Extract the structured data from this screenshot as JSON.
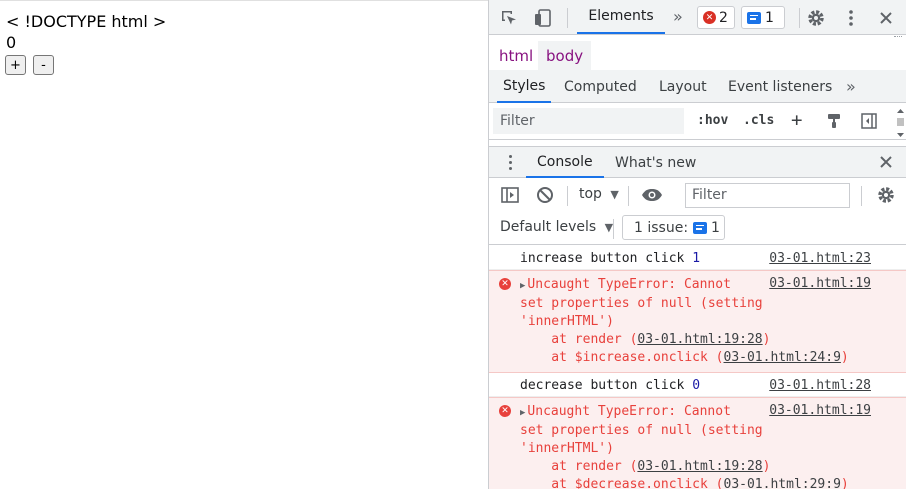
{
  "page": {
    "doctype_text": "< !DOCTYPE html >",
    "count": "0",
    "increase_label": "+",
    "decrease_label": "-"
  },
  "devtools": {
    "main_tab": "Elements",
    "more_tabs": "»",
    "error_count": "2",
    "issue_count": "1",
    "breadcrumb": [
      "html",
      "body"
    ],
    "styles_tabs": [
      "Styles",
      "Computed",
      "Layout",
      "Event listeners"
    ],
    "styles_more": "»",
    "styles_filter_placeholder": "Filter",
    "hov_label": ":hov",
    "cls_label": ".cls",
    "add_label": "+",
    "drawer_tabs": [
      "Console",
      "What's new"
    ],
    "context": "top",
    "console_filter_placeholder": "Filter",
    "levels": "Default levels",
    "issues_button": "1 issue:",
    "issues_button_count": "1"
  },
  "console": {
    "messages": [
      {
        "type": "log",
        "text": "increase button click ",
        "value": "1",
        "source": "03-01.html:23"
      },
      {
        "type": "error",
        "lines": [
          "Uncaught TypeError: Cannot",
          "set properties of null (setting",
          "'innerHTML')"
        ],
        "source": "03-01.html:19",
        "stack": [
          {
            "prefix": "    at render (",
            "link": "03-01.html:19:28",
            "suffix": ")"
          },
          {
            "prefix": "    at $increase.onclick (",
            "link": "03-01.html:24:9",
            "suffix": ")"
          }
        ]
      },
      {
        "type": "log",
        "text": "decrease button click ",
        "value": "0",
        "source": "03-01.html:28"
      },
      {
        "type": "error",
        "lines": [
          "Uncaught TypeError: Cannot",
          "set properties of null (setting",
          "'innerHTML')"
        ],
        "source": "03-01.html:19",
        "stack": [
          {
            "prefix": "    at render (",
            "link": "03-01.html:19:28",
            "suffix": ")"
          },
          {
            "prefix": "    at $decrease.onclick (",
            "link": "03-01.html:29:9",
            "suffix": ")"
          }
        ]
      }
    ]
  },
  "colors": {
    "accent": "#1a73e8",
    "error": "#e8413c",
    "error_bg": "#fcefef",
    "tag": "#881280"
  }
}
